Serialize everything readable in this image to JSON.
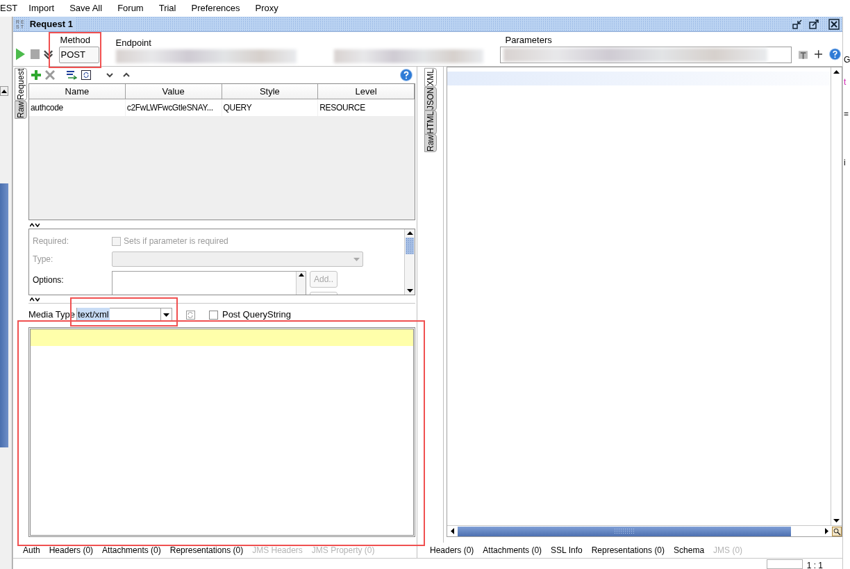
{
  "menu": [
    {
      "label": "EST"
    },
    {
      "label": "Import"
    },
    {
      "label": "Save All"
    },
    {
      "label": "Forum"
    },
    {
      "label": "Trial"
    },
    {
      "label": "Preferences"
    },
    {
      "label": "Proxy"
    }
  ],
  "window": {
    "title": "Request 1",
    "icon_text": [
      "RE",
      "ST"
    ]
  },
  "toolbar": {
    "method_label": "Method",
    "method": "POST",
    "endpoint_label": "Endpoint",
    "parameters_label": "Parameters"
  },
  "request_tabs": [
    {
      "label": "Request",
      "selected": true
    },
    {
      "label": "Raw",
      "selected": false
    }
  ],
  "params_table": {
    "columns": [
      "Name",
      "Value",
      "Style",
      "Level"
    ],
    "rows": [
      [
        "authcode",
        "c2FwLWFwcGtleSNAY...",
        "QUERY",
        "RESOURCE"
      ]
    ]
  },
  "param_details": {
    "required_label": "Required:",
    "required_text": "Sets if parameter is required",
    "required_checked": false,
    "type_label": "Type:",
    "options_label": "Options:",
    "add_button": "Add.."
  },
  "media": {
    "label": "Media Type",
    "value": "text/xml",
    "post_querystring_label": "Post QueryString",
    "post_querystring_checked": false
  },
  "request_bottom_tabs": [
    {
      "label": "Auth",
      "disabled": false
    },
    {
      "label": "Headers (0)",
      "disabled": false
    },
    {
      "label": "Attachments (0)",
      "disabled": false
    },
    {
      "label": "Representations (0)",
      "disabled": false
    },
    {
      "label": "JMS Headers",
      "disabled": true
    },
    {
      "label": "JMS Property (0)",
      "disabled": true
    }
  ],
  "response_tabs": [
    {
      "label": "XML",
      "selected": true
    },
    {
      "label": "JSON",
      "selected": false
    },
    {
      "label": "HTML",
      "selected": false
    },
    {
      "label": "Raw",
      "selected": false
    }
  ],
  "response_bottom_tabs": [
    {
      "label": "Headers (0)",
      "disabled": false
    },
    {
      "label": "Attachments (0)",
      "disabled": false
    },
    {
      "label": "SSL Info",
      "disabled": false
    },
    {
      "label": "Representations (0)",
      "disabled": false
    },
    {
      "label": "Schema",
      "disabled": false
    },
    {
      "label": "JMS (0)",
      "disabled": true
    }
  ],
  "edge_fragments": [
    "G",
    "t",
    "=",
    "i"
  ],
  "status_bar": {
    "position": "1 : 1"
  }
}
